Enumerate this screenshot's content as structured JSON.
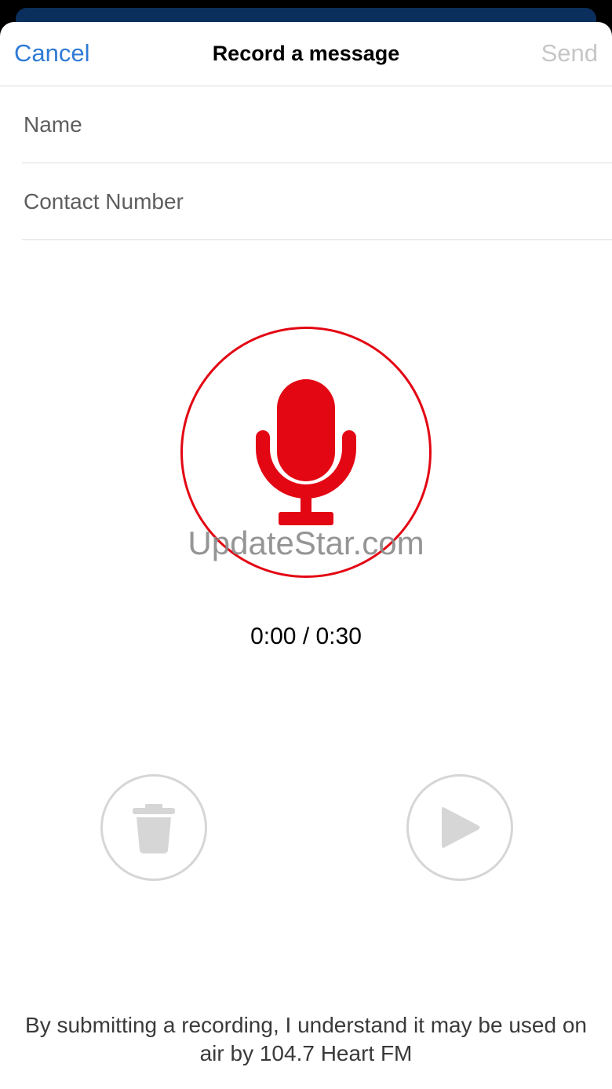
{
  "nav": {
    "cancel_label": "Cancel",
    "title": "Record a message",
    "send_label": "Send"
  },
  "form": {
    "name_placeholder": "Name",
    "contact_placeholder": "Contact Number"
  },
  "recorder": {
    "icon": "microphone-icon",
    "timer": "0:00 / 0:30"
  },
  "watermark": "UpdateStar.com",
  "controls": {
    "delete_icon": "trash-icon",
    "play_icon": "play-icon"
  },
  "disclaimer": "By submitting a recording, I understand it may be used on air by 104.7 Heart FM",
  "colors": {
    "accent": "#2f7ad6",
    "record_red": "#e30613",
    "disabled_gray": "#c6c6c6",
    "header_navy": "#0b2f5c"
  }
}
